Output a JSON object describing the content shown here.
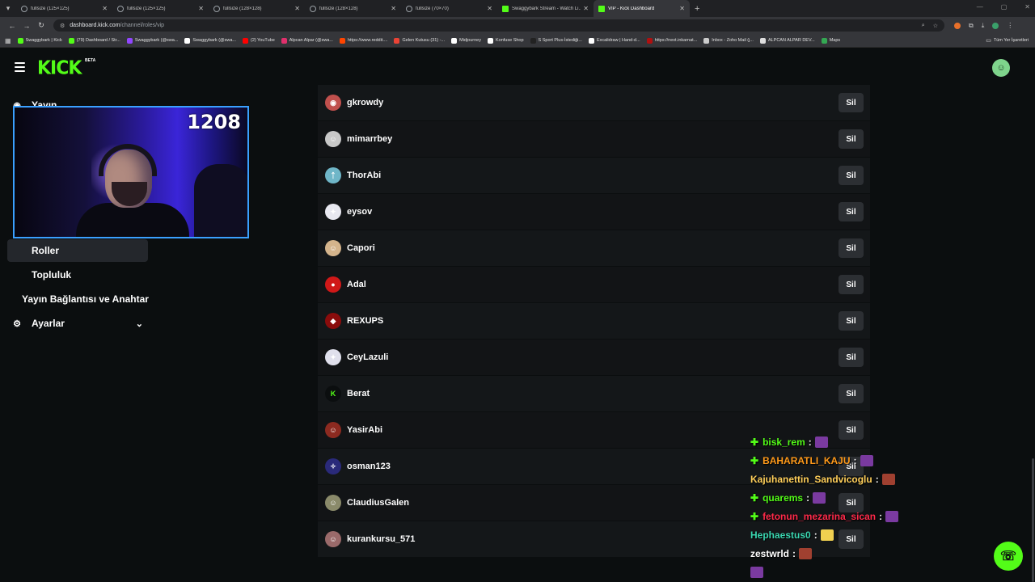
{
  "browser": {
    "tabs": [
      {
        "label": "fullsize (125×125)",
        "kick": false,
        "active": false
      },
      {
        "label": "fullsize (125×125)",
        "kick": false,
        "active": false
      },
      {
        "label": "fullsize (128×128)",
        "kick": false,
        "active": false
      },
      {
        "label": "fullsize (128×128)",
        "kick": false,
        "active": false
      },
      {
        "label": "fullsize (70×70)",
        "kick": false,
        "active": false
      },
      {
        "label": "Swaggybark Stream - Watch Li...",
        "kick": true,
        "active": false
      },
      {
        "label": "VIP - Kick Dashboard",
        "kick": true,
        "active": true
      }
    ],
    "new_tab": "+",
    "url_host": "dashboard.kick.com",
    "url_path": "/channel/roles/vip",
    "bookmarks": [
      {
        "label": "Swaggybark | Kick",
        "color": "#53fc18"
      },
      {
        "label": "(79) Dashboard / Str...",
        "color": "#53fc18"
      },
      {
        "label": "Swaggybark (@swa...",
        "color": "#9146ff"
      },
      {
        "label": "Swaggybark (@swa...",
        "color": "#ffffff"
      },
      {
        "label": "(2) YouTube",
        "color": "#ff0000"
      },
      {
        "label": "Alpcan Alpar (@swa...",
        "color": "#e1306c"
      },
      {
        "label": "https://www.reddit....",
        "color": "#ff4500"
      },
      {
        "label": "Gelen Kutusu (31) -...",
        "color": "#ea4335"
      },
      {
        "label": "Midjourney",
        "color": "#ffffff"
      },
      {
        "label": "Konfuse Shop",
        "color": "#ffffff"
      },
      {
        "label": "S Sport Plus-İstediği...",
        "color": "#222222"
      },
      {
        "label": "Excalidraw | Hand-d...",
        "color": "#ffffff"
      },
      {
        "label": "https://next.inkarnat...",
        "color": "#b01010"
      },
      {
        "label": "Inbox - Zoho Mail (j...",
        "color": "#cccccc"
      },
      {
        "label": "ALPCAN ALPAR DEV...",
        "color": "#dddddd"
      },
      {
        "label": "Maps",
        "color": "#34a853"
      }
    ],
    "bookmarks_right": "Tüm Yer İşaretleri"
  },
  "header": {
    "logo": "KICK",
    "beta": "BETA"
  },
  "sidebar": {
    "items": [
      {
        "label": "Yayın",
        "icon": "broadcast-icon"
      },
      {
        "label": "Roller"
      },
      {
        "label": "Topluluk"
      },
      {
        "label": "Yayın Bağlantısı ve Anahtar"
      },
      {
        "label": "Ayarlar",
        "icon": "gear-icon"
      }
    ]
  },
  "webcam": {
    "counter": "1208"
  },
  "vip_list": {
    "remove_label": "Sil",
    "users": [
      {
        "name": "gkrowdy",
        "avatar_color": "#c0504d",
        "glyph": "◉"
      },
      {
        "name": "mimarrbey",
        "avatar_color": "#c8c8c8",
        "glyph": "☺"
      },
      {
        "name": "ThorAbi",
        "avatar_color": "#6fb6c8",
        "glyph": "ᛏ"
      },
      {
        "name": "eysov",
        "avatar_color": "#e8e8f0",
        "glyph": "✦"
      },
      {
        "name": "Capori",
        "avatar_color": "#d4b48c",
        "glyph": "☺"
      },
      {
        "name": "Adal",
        "avatar_color": "#d01818",
        "glyph": "●"
      },
      {
        "name": "REXUPS",
        "avatar_color": "#8a0c0c",
        "glyph": "◆"
      },
      {
        "name": "CeyLazuli",
        "avatar_color": "#e0e0ec",
        "glyph": "✦"
      },
      {
        "name": "Berat",
        "avatar_color": "#0b0e0f",
        "glyph": "K"
      },
      {
        "name": "YasirAbi",
        "avatar_color": "#8c2a20",
        "glyph": "☺"
      },
      {
        "name": "osman123",
        "avatar_color": "#2a2a7a",
        "glyph": "✧"
      },
      {
        "name": "ClaudiusGalen",
        "avatar_color": "#8a8a6a",
        "glyph": "☺"
      },
      {
        "name": "kurankursu_571",
        "avatar_color": "#9a6a6a",
        "glyph": "☺"
      }
    ]
  },
  "chat": [
    {
      "user": "bisk_rem",
      "color": "#53fc18",
      "badge": true,
      "emote": "#7a3aa0"
    },
    {
      "user": "BAHARATLI_KAJU",
      "color": "#ff9a1a",
      "badge": true,
      "emote": "#7a3aa0"
    },
    {
      "user": "Kajuhanettin_Sandvicoglu",
      "color": "#ffcf5a",
      "badge": false,
      "emote": "#a04030"
    },
    {
      "user": "quarems",
      "color": "#53fc18",
      "badge": true,
      "emote": "#7a3aa0"
    },
    {
      "user": "fetonun_mezarina_sican",
      "color": "#ff2a4a",
      "badge": true,
      "emote": "#7a3aa0"
    },
    {
      "user": "Hephaestus0",
      "color": "#3ad6b0",
      "badge": false,
      "emote": "#f0d050"
    },
    {
      "user": "zestwrld",
      "color": "#ffffff",
      "badge": false,
      "emote": "#a04030"
    }
  ]
}
